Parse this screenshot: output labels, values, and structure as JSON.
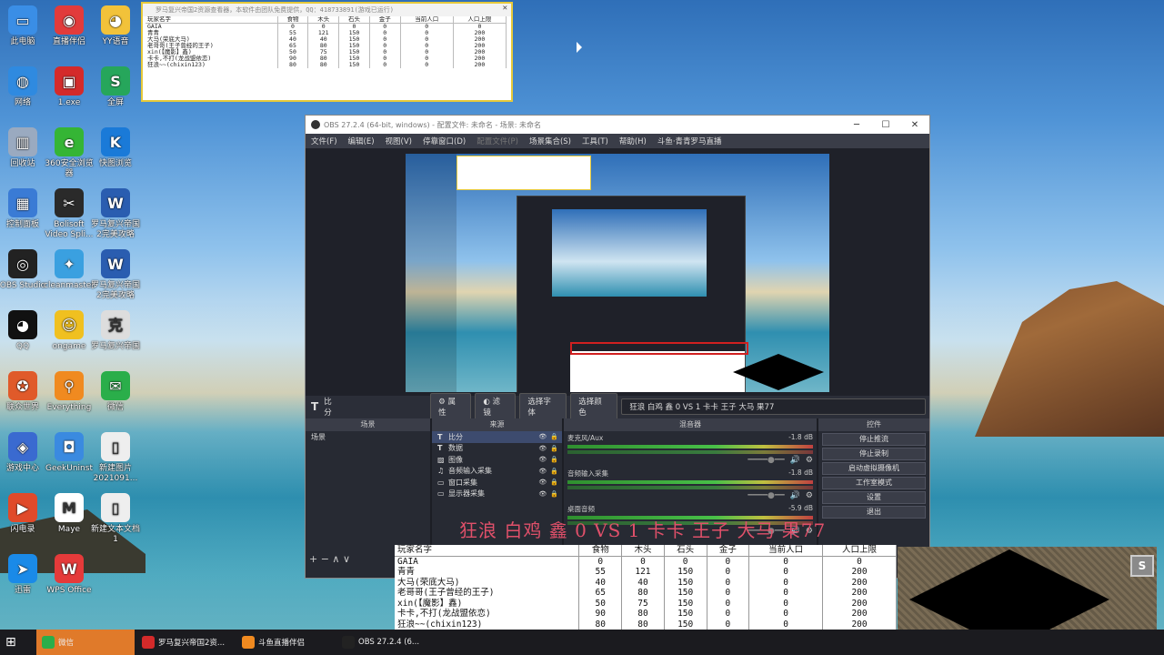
{
  "desktop_icons": [
    {
      "label": "此电脑",
      "color": "#3a8ee6",
      "glyph": "▭"
    },
    {
      "label": "直播伴侣",
      "color": "#e23b3b",
      "glyph": "◉"
    },
    {
      "label": "YY语音",
      "color": "#f2c23a",
      "glyph": "◕"
    },
    {
      "label": "网络",
      "color": "#2f8ae0",
      "glyph": "◍"
    },
    {
      "label": "1.exe",
      "color": "#d42a2a",
      "glyph": "▣"
    },
    {
      "label": "全屏",
      "color": "#26a65b",
      "glyph": "S"
    },
    {
      "label": "回收站",
      "color": "#9aaac0",
      "glyph": "▥"
    },
    {
      "label": "360安全浏览器",
      "color": "#35b535",
      "glyph": "e"
    },
    {
      "label": "快图浏览",
      "color": "#1a7ad8",
      "glyph": "K"
    },
    {
      "label": "控制面板",
      "color": "#3a7bd5",
      "glyph": "▦"
    },
    {
      "label": "Bolisoft Video Spli...",
      "color": "#2a2a2a",
      "glyph": "✂"
    },
    {
      "label": "罗马复兴帝国2完美攻略",
      "color": "#2a5db0",
      "glyph": "W"
    },
    {
      "label": "OBS Studio",
      "color": "#222",
      "glyph": "◎"
    },
    {
      "label": "cleanmaster",
      "color": "#3aa0e0",
      "glyph": "✦"
    },
    {
      "label": "罗马复兴帝国2完美攻略",
      "color": "#2a5db0",
      "glyph": "W"
    },
    {
      "label": "QQ",
      "color": "#111",
      "glyph": "◕"
    },
    {
      "label": "ongame",
      "color": "#f0c020",
      "glyph": "☺"
    },
    {
      "label": "罗马复兴帝国",
      "color": "#ddd",
      "glyph": "克"
    },
    {
      "label": "联众世界",
      "color": "#e05a2a",
      "glyph": "✪"
    },
    {
      "label": "Everything",
      "color": "#f08a20",
      "glyph": "⚲"
    },
    {
      "label": "微信",
      "color": "#2aae4a",
      "glyph": "✉"
    },
    {
      "label": "游戏中心",
      "color": "#3a6ad0",
      "glyph": "◈"
    },
    {
      "label": "GeekUninst",
      "color": "#3a8ae0",
      "glyph": "◘"
    },
    {
      "label": "新建图片2021091...",
      "color": "#eee",
      "glyph": "▯"
    },
    {
      "label": "闪电录",
      "color": "#e04a2a",
      "glyph": "▶"
    },
    {
      "label": "Maye",
      "color": "#fff",
      "glyph": "M"
    },
    {
      "label": "新建文本文档1",
      "color": "#eee",
      "glyph": "▯"
    },
    {
      "label": "迅雷",
      "color": "#1a8ae8",
      "glyph": "➤"
    },
    {
      "label": "WPS Office",
      "color": "#e53a3a",
      "glyph": "W"
    }
  ],
  "stat_window": {
    "title": "罗马复兴帝国2资源查看器，本软件由团队免费提供，QQ：418733891(游戏已运行)",
    "close": "✕",
    "headers": [
      "玩家名字",
      "食物",
      "木头",
      "石头",
      "金子",
      "当前人口",
      "人口上限"
    ],
    "rows": [
      [
        "GAIA",
        "0",
        "0",
        "0",
        "0",
        "0",
        "0"
      ],
      [
        "青青",
        "55",
        "121",
        "150",
        "0",
        "0",
        "200"
      ],
      [
        "大马(荣底大马)",
        "40",
        "40",
        "150",
        "0",
        "0",
        "200"
      ],
      [
        "老哥哥(王子曾经的王子)",
        "65",
        "80",
        "150",
        "0",
        "0",
        "200"
      ],
      [
        "xin(【魔影】鑫)",
        "50",
        "75",
        "150",
        "0",
        "0",
        "200"
      ],
      [
        "卡卡,不打(龙战盟依恋)",
        "90",
        "80",
        "150",
        "0",
        "0",
        "200"
      ],
      [
        "狂浪~~(chixin123)",
        "80",
        "80",
        "150",
        "0",
        "0",
        "200"
      ]
    ]
  },
  "obs": {
    "title": "OBS 27.2.4 (64-bit, windows) - 配置文件: 未命名 - 场景: 未命名",
    "menu": [
      "文件(F)",
      "编辑(E)",
      "视图(V)",
      "停靠窗口(D)",
      "配置文件(P)",
      "场景集合(S)",
      "工具(T)",
      "帮助(H)",
      "斗鱼·青青罗马直播"
    ],
    "menu_dim": [
      false,
      false,
      false,
      false,
      true,
      false,
      false,
      false,
      false
    ],
    "source_bar": {
      "name": "比分",
      "props": "属性",
      "filters": "滤镜",
      "font": "选择字体",
      "color": "选择颜色",
      "text": "狂浪 白鸡 鑫 0 VS 1 卡卡 王子 大马 果77"
    },
    "docks": {
      "scenes": "场景",
      "sources": "来源",
      "mixer": "混音器",
      "controls": "控件"
    },
    "scene_item": "场景",
    "sources": [
      {
        "icon": "T",
        "name": "比分"
      },
      {
        "icon": "T",
        "name": "数据"
      },
      {
        "icon": "▨",
        "name": "图像"
      },
      {
        "icon": "♫",
        "name": "音频输入采集"
      },
      {
        "icon": "▭",
        "name": "窗口采集"
      },
      {
        "icon": "▭",
        "name": "显示器采集"
      }
    ],
    "mixer": [
      {
        "name": "麦克风/Aux",
        "db": "-1.8 dB"
      },
      {
        "name": "音频输入采集",
        "db": "-1.8 dB"
      },
      {
        "name": "桌面音频",
        "db": "-5.9 dB"
      }
    ],
    "controls": [
      "停止推流",
      "停止录制",
      "启动虚拟摄像机",
      "工作室模式",
      "设置",
      "退出"
    ]
  },
  "overlay_score": "狂浪 白鸡 鑫 0 VS 1 卡卡 王子 大马 果77",
  "big_table": {
    "headers": [
      "玩家名字",
      "食物",
      "木头",
      "石头",
      "金子",
      "当前人口",
      "人口上限"
    ],
    "rows": [
      [
        "GAIA",
        "0",
        "0",
        "0",
        "0",
        "0",
        "0"
      ],
      [
        "青青",
        "55",
        "121",
        "150",
        "0",
        "0",
        "200"
      ],
      [
        "大马(荣底大马)",
        "40",
        "40",
        "150",
        "0",
        "0",
        "200"
      ],
      [
        "老哥哥(王子曾经的王子)",
        "65",
        "80",
        "150",
        "0",
        "0",
        "200"
      ],
      [
        "xin(【魔影】鑫)",
        "50",
        "75",
        "150",
        "0",
        "0",
        "200"
      ],
      [
        "卡卡,不打(龙战盟依恋)",
        "90",
        "80",
        "150",
        "0",
        "0",
        "200"
      ],
      [
        "狂浪~~(chixin123)",
        "80",
        "80",
        "150",
        "0",
        "0",
        "200"
      ]
    ]
  },
  "game_buttons": {
    "s": "S",
    "q": "?"
  },
  "taskbar": [
    {
      "label": "微信",
      "color": "#2aae4a",
      "active": true
    },
    {
      "label": "罗马复兴帝国2资...",
      "color": "#d42a2a",
      "active": false
    },
    {
      "label": "斗鱼直播伴侣",
      "color": "#f08a20",
      "active": false
    },
    {
      "label": "OBS 27.2.4 (6...",
      "color": "#222",
      "active": false
    }
  ]
}
